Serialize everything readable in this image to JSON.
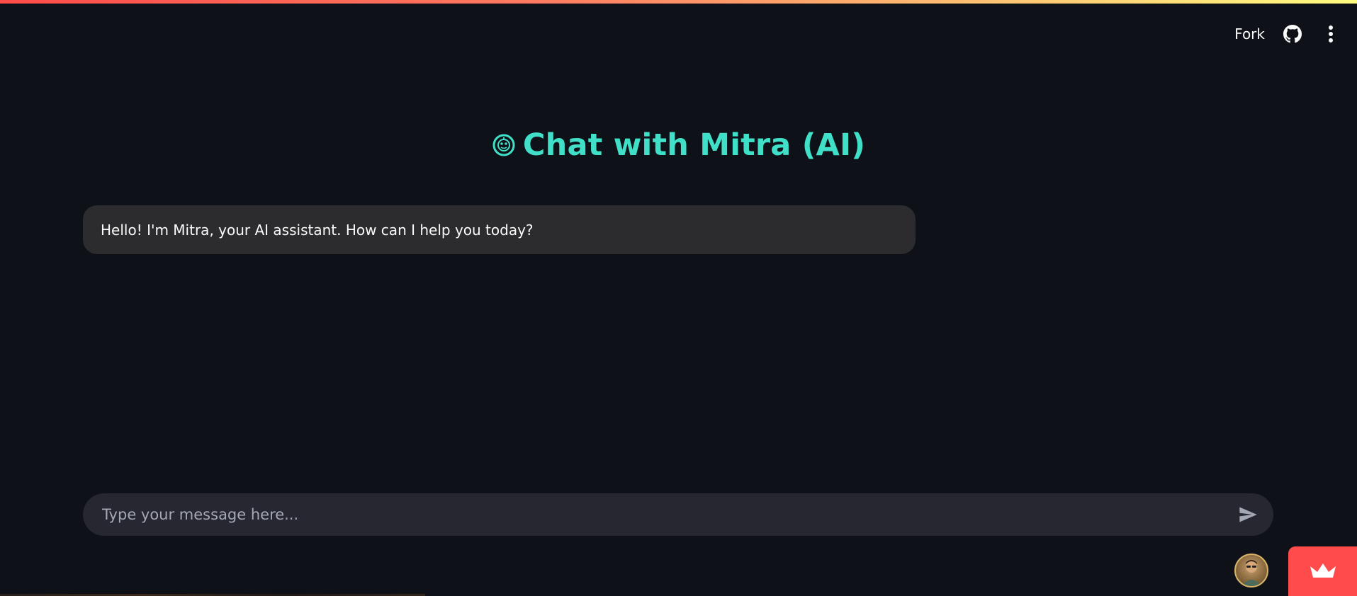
{
  "header": {
    "fork_label": "Fork",
    "github_icon": "github-icon",
    "menu_icon": "kebab-menu-icon"
  },
  "main": {
    "title_icon": "robot-face-icon",
    "title": "Chat with Mitra (AI)",
    "messages": [
      {
        "role": "assistant",
        "text": "Hello! I'm Mitra, your AI assistant. How can I help you today?"
      }
    ]
  },
  "chat_input": {
    "placeholder": "Type your message here...",
    "value": "",
    "send_icon": "send-arrow-icon"
  },
  "footer": {
    "avatar": "user-avatar",
    "badge_icon": "streamlit-crown-icon"
  },
  "colors": {
    "background": "#0e1117",
    "title": "#40e0c8",
    "bubble": "#2c2c2e",
    "input": "#262730",
    "badge": "#ff4b4b"
  }
}
